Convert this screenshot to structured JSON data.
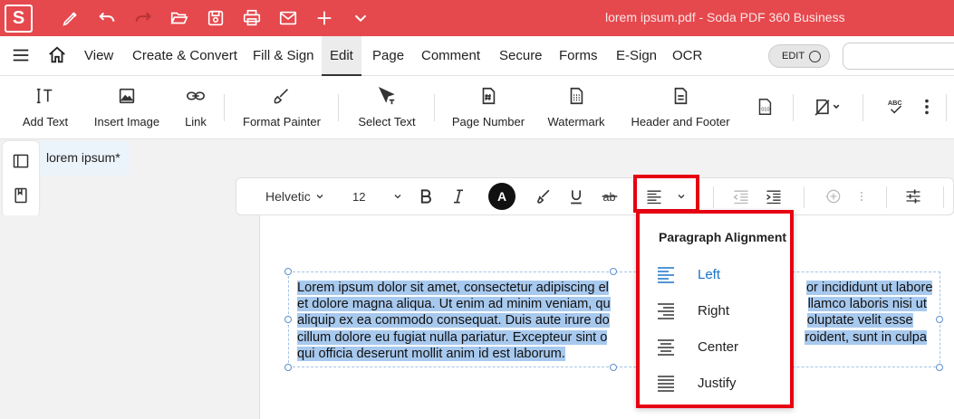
{
  "window": {
    "app_logo": "S",
    "title": "lorem ipsum.pdf   -   Soda PDF 360 Business"
  },
  "quick_access": [
    "pen-icon",
    "undo-icon",
    "redo-icon",
    "open-folder-icon",
    "save-icon",
    "print-icon",
    "email-icon",
    "plus-icon",
    "chevron-down-icon"
  ],
  "menubar": {
    "items": [
      "View",
      "Create & Convert",
      "Fill & Sign",
      "Edit",
      "Page",
      "Comment",
      "Secure",
      "Forms",
      "E-Sign",
      "OCR"
    ],
    "active": "Edit",
    "edit_toggle_label": "EDIT"
  },
  "ribbon": {
    "buttons": [
      "Add Text",
      "Insert Image",
      "Link",
      "Format Painter",
      "Select Text",
      "Page Number",
      "Watermark",
      "Header and Footer"
    ]
  },
  "document_tab": {
    "label": "lorem ipsum*"
  },
  "format_toolbar": {
    "font_family": "Helvetic",
    "font_size": "12",
    "font_color_glyph": "A"
  },
  "text_box": {
    "lines": [
      "Lorem ipsum dolor sit amet, consectetur adipiscing el",
      "or incididunt ut labore",
      "et dolore magna aliqua. Ut enim ad minim veniam, qu",
      "llamco laboris nisi ut",
      "aliquip ex ea commodo consequat. Duis aute irure do",
      "oluptate velit esse",
      "cillum dolore eu fugiat nulla pariatur. Excepteur sint o",
      "roident, sunt in culpa",
      "qui officia deserunt mollit anim id est laborum."
    ]
  },
  "alignment_menu": {
    "title": "Paragraph Alignment",
    "items": [
      "Left",
      "Right",
      "Center",
      "Justify"
    ],
    "selected": "Left"
  },
  "colors": {
    "titlebar": "#e5484d",
    "highlight_box": "#e60012",
    "selection": "#a8c9ee",
    "selected_item": "#1a73c9"
  }
}
